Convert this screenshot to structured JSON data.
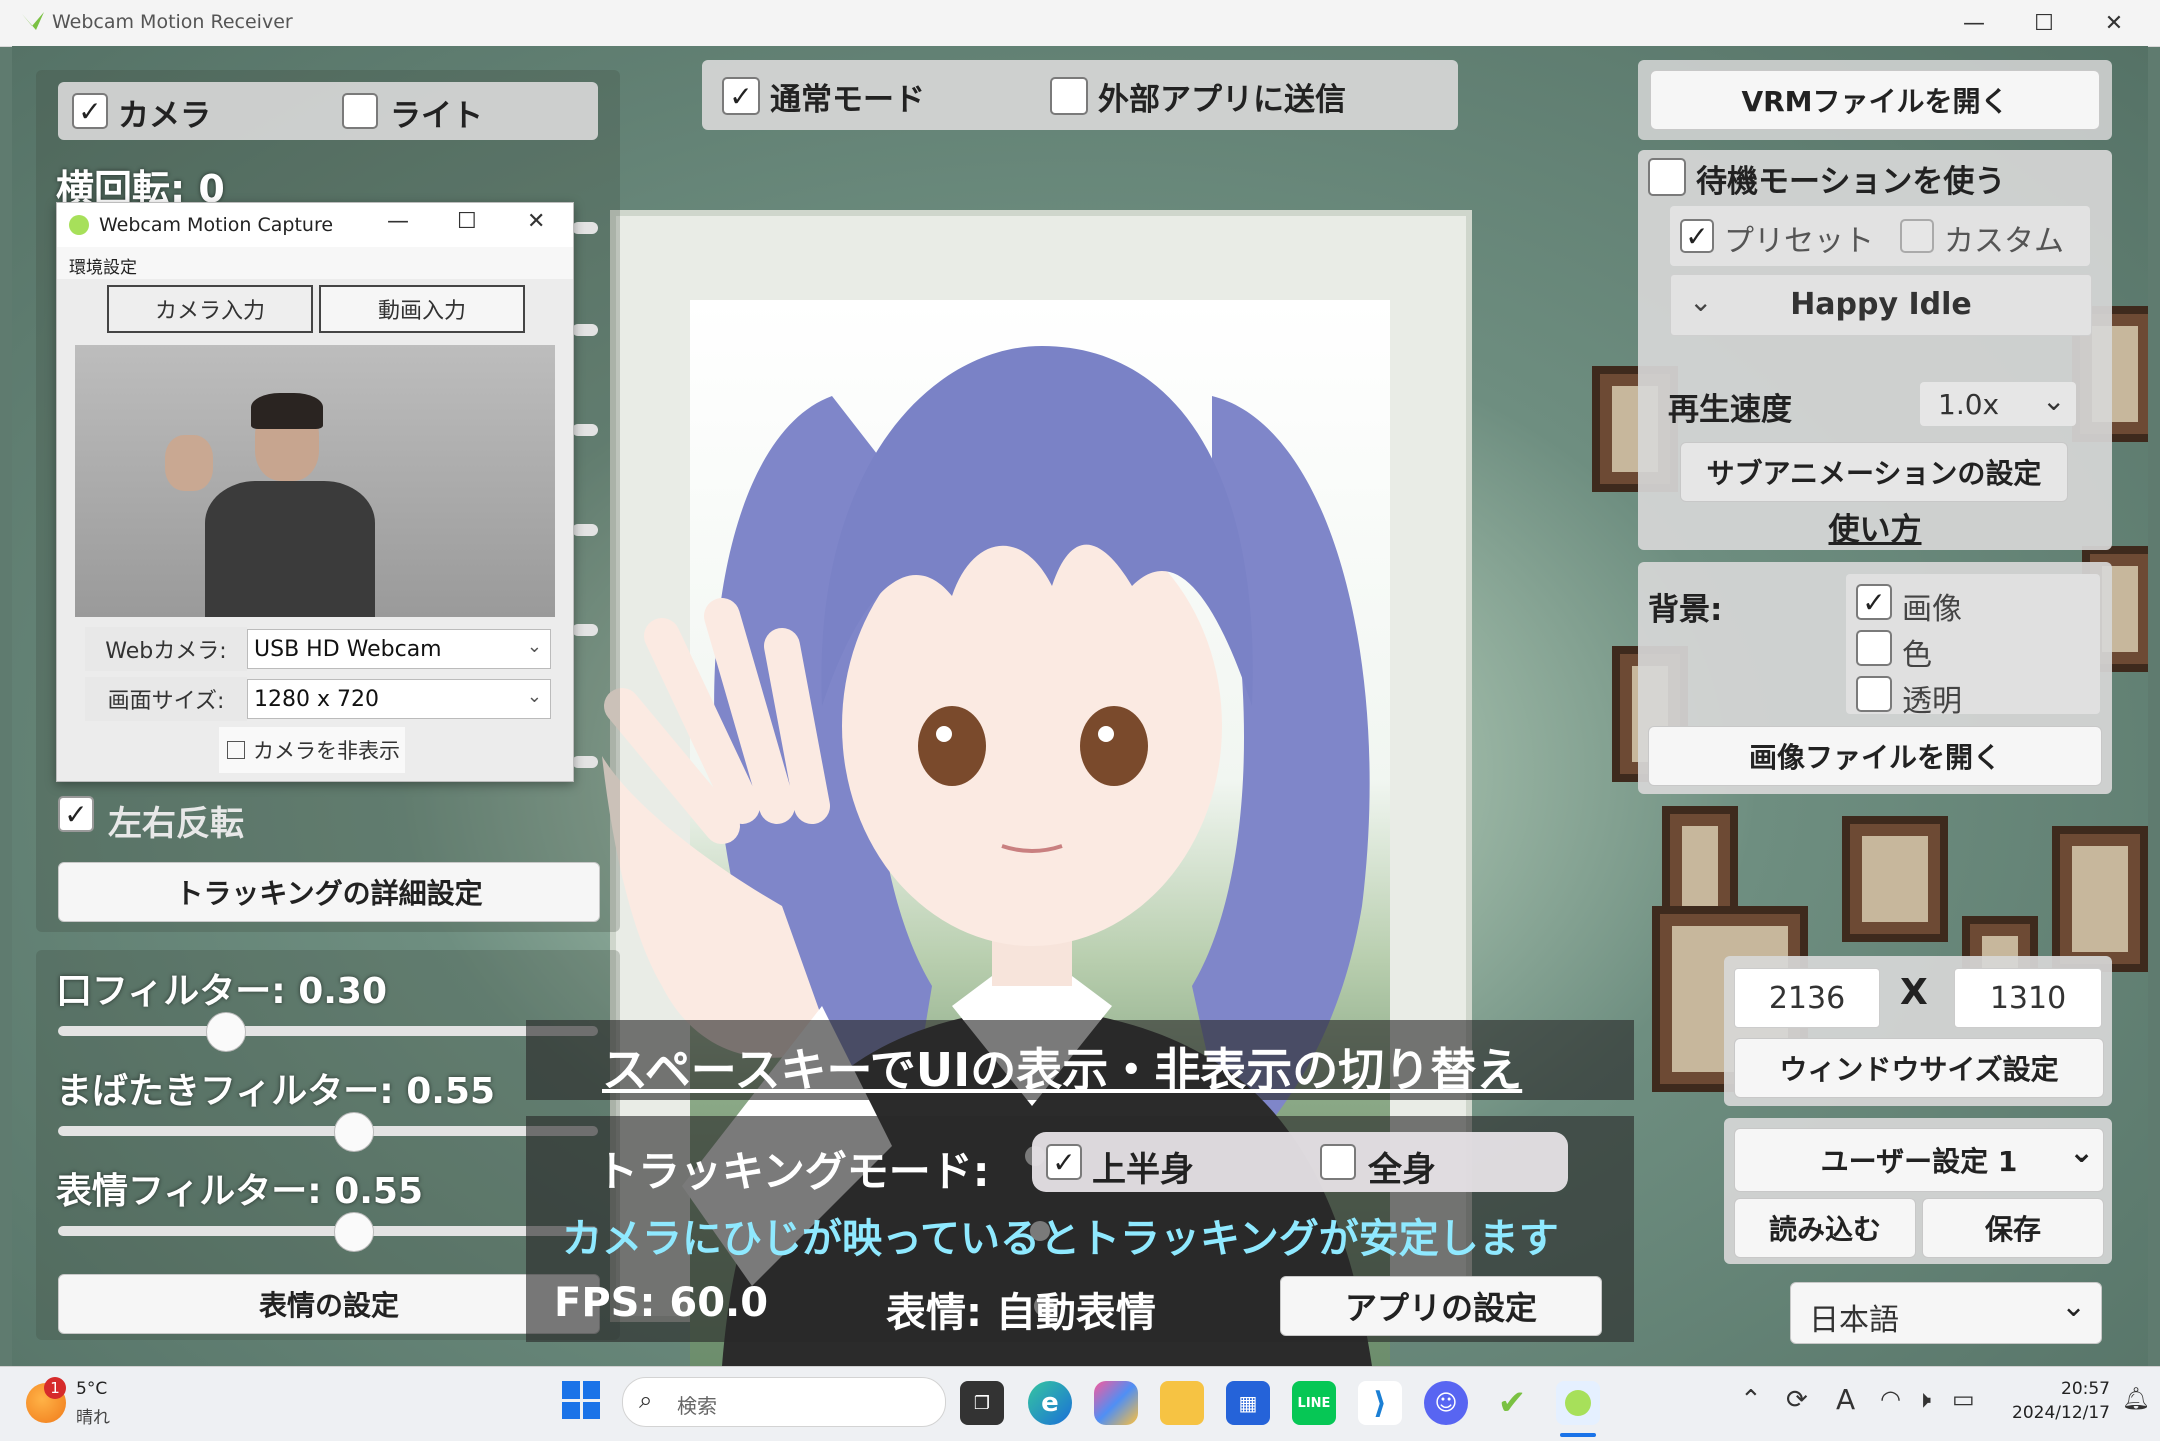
{
  "window": {
    "title": "Webcam Motion Receiver"
  },
  "left_top": {
    "camera_label": "カメラ",
    "camera_checked": true,
    "light_label": "ライト",
    "light_checked": false
  },
  "rotation": {
    "label": "横回転: 0"
  },
  "capture": {
    "title": "Webcam Motion Capture",
    "menu": "環境設定",
    "tabs": [
      "カメラ入力",
      "動画入力"
    ],
    "webcam_label": "Webカメラ:",
    "webcam_value": "USB HD Webcam",
    "size_label": "画面サイズ:",
    "size_value": "1280 x 720",
    "hide_camera": "カメラを非表示"
  },
  "mirror": {
    "label": "左右反転",
    "checked": true
  },
  "tracking_detail_button": "トラッキングの詳細設定",
  "filters": [
    {
      "label": "口フィルター: 0.30",
      "value": 0.3
    },
    {
      "label": "まばたきフィルター: 0.55",
      "value": 0.55
    },
    {
      "label": "表情フィルター: 0.55",
      "value": 0.55
    }
  ],
  "expression_settings_button": "表情の設定",
  "top_center": {
    "normal_mode": "通常モード",
    "normal_checked": true,
    "send_external": "外部アプリに送信",
    "send_checked": false
  },
  "right": {
    "open_vrm": "VRMファイルを開く",
    "idle_motion": "待機モーションを使う",
    "preset": "プリセット",
    "custom": "カスタム",
    "motion_select": "Happy Idle",
    "speed_label": "再生速度",
    "speed_value": "1.0x",
    "sub_anim": "サブアニメーションの設定",
    "howto": "使い方",
    "bg_label": "背景:",
    "bg_image": "画像",
    "bg_color": "色",
    "bg_transparent": "透明",
    "open_image": "画像ファイルを開く",
    "width": "2136",
    "x": "X",
    "height": "1310",
    "window_size": "ウィンドウサイズ設定",
    "user_setting": "ユーザー設定 1",
    "load": "読み込む",
    "save": "保存",
    "language": "日本語"
  },
  "center": {
    "space_hint": "スペースキーでUIの表示・非表示の切り替え",
    "tracking_mode_label": "トラッキングモード:",
    "upper_body": "上半身",
    "full_body": "全身",
    "elbow_hint": "カメラにひじが映っているとトラッキングが安定します",
    "fps": "FPS: 60.0",
    "expression": "表情: 自動表情",
    "app_settings": "アプリの設定"
  },
  "taskbar": {
    "temp": "5°C",
    "weather": "晴れ",
    "badge": "1",
    "search_placeholder": "検索",
    "time": "20:57",
    "date": "2024/12/17",
    "ime": "A"
  },
  "colors": {
    "panel": "#d7d7d7",
    "accent": "#1a73e8",
    "hair": "#7f86c9"
  }
}
